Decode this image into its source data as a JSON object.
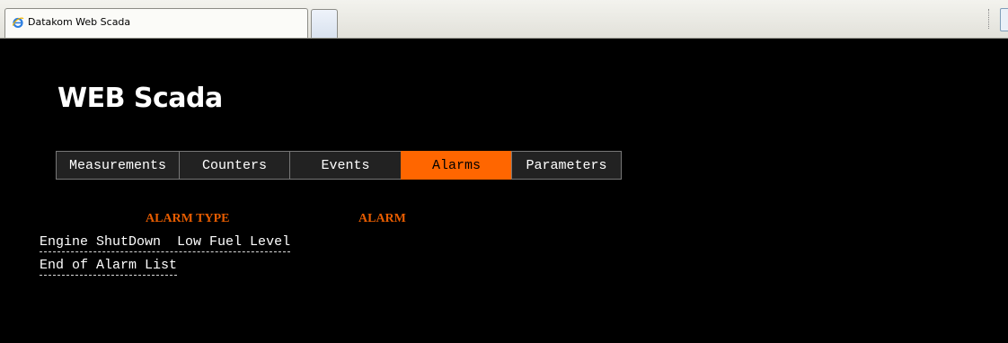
{
  "browser": {
    "tab_title": "Datakom Web Scada",
    "tab_icon": "ie-icon"
  },
  "page": {
    "title": "WEB Scada"
  },
  "nav": {
    "items": [
      "Measurements",
      "Counters",
      "Events",
      "Alarms",
      "Parameters"
    ],
    "active": "Alarms",
    "accent_color": "#ff6600"
  },
  "alarms": {
    "headers": {
      "type": "ALARM TYPE",
      "alarm": "ALARM"
    },
    "header_color": "#e65c00",
    "rows": [
      {
        "type": "Engine ShutDown",
        "alarm": "Low Fuel Level"
      }
    ],
    "end_text": "End of Alarm List"
  }
}
